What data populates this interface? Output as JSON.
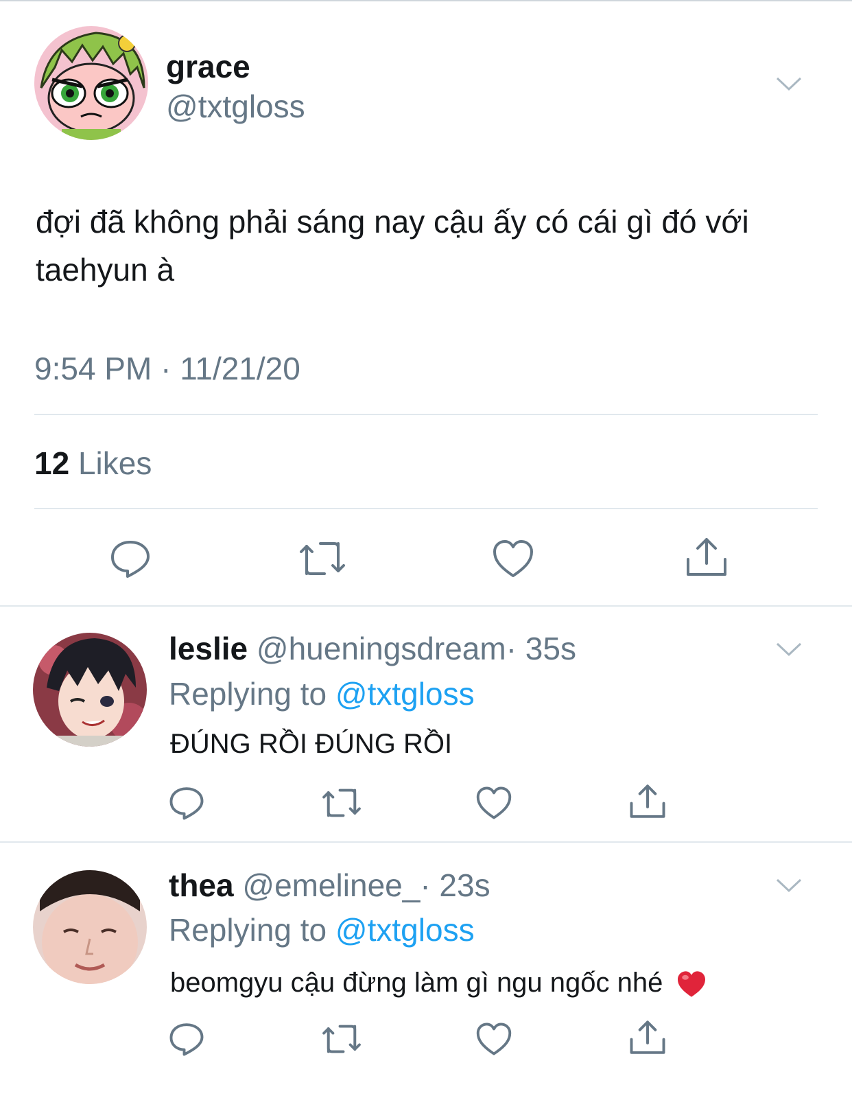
{
  "main_tweet": {
    "name": "grace",
    "handle": "@txtgloss",
    "text": "đợi đã không phải sáng nay cậu ấy có cái gì đó với taehyun à",
    "timestamp": "9:54 PM · 11/21/20",
    "likes_count": "12",
    "likes_label": "Likes"
  },
  "replies": [
    {
      "name": "leslie",
      "handle": "@hueningsdream",
      "time": "· 35s",
      "replying_prefix": "Replying to",
      "replying_handle": "@txtgloss",
      "text": "ĐÚNG RỒI ĐÚNG RỒI"
    },
    {
      "name": "thea",
      "handle": "@emelinee_",
      "time": "· 23s",
      "replying_prefix": "Replying to",
      "replying_handle": "@txtgloss",
      "text": "beomgyu cậu đừng làm gì ngu ngốc nhé"
    }
  ],
  "colors": {
    "text": "#14171a",
    "secondary": "#657786",
    "link": "#1da1f2",
    "divider": "#e1e8ed",
    "heart_emoji": "#e0243a"
  },
  "icons": [
    "reply-icon",
    "retweet-icon",
    "like-icon",
    "share-icon",
    "chevron-down-icon",
    "red-heart-emoji"
  ]
}
